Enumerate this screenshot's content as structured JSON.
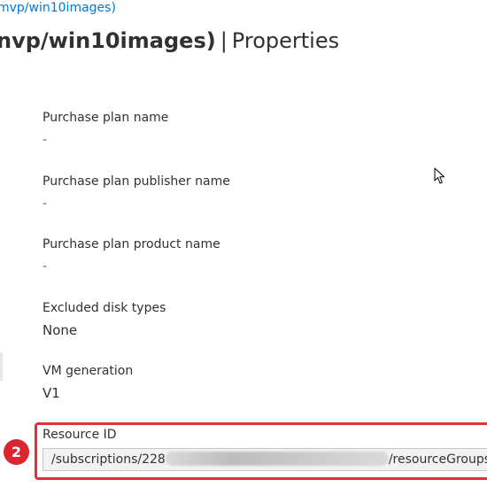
{
  "breadcrumb": {
    "link_text": "mvp/win10images)"
  },
  "header": {
    "title_strong": "nvp/win10images)",
    "separator": "|",
    "title_section": "Properties"
  },
  "properties": [
    {
      "label": "Purchase plan name",
      "value": "-"
    },
    {
      "label": "Purchase plan publisher name",
      "value": "-"
    },
    {
      "label": "Purchase plan product name",
      "value": "-"
    },
    {
      "label": "Excluded disk types",
      "value": "None"
    },
    {
      "label": "VM generation",
      "value": "V1"
    }
  ],
  "resource_id": {
    "label": "Resource ID",
    "value_prefix": "/subscriptions/228",
    "value_suffix": "/resourceGroups/ai"
  },
  "annotation": {
    "step_number": "2",
    "highlight_color": "#e0323c"
  },
  "icons": {
    "cursor": "mouse-pointer-icon"
  },
  "colors": {
    "link": "#0078d4",
    "text": "#323130",
    "muted": "#605e5c"
  }
}
